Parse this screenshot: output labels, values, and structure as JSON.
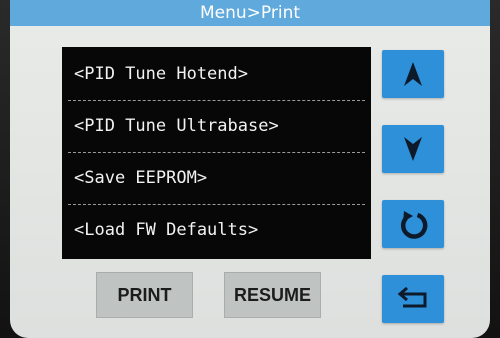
{
  "header": {
    "title": "Menu>Print"
  },
  "menu": {
    "items": [
      {
        "label": "<PID Tune Hotend>"
      },
      {
        "label": "<PID Tune Ultrabase>"
      },
      {
        "label": "<Save EEPROM>"
      },
      {
        "label": "<Load FW Defaults>"
      }
    ]
  },
  "side_buttons": [
    {
      "icon": "arrow-up-icon"
    },
    {
      "icon": "arrow-down-icon"
    },
    {
      "icon": "refresh-icon"
    },
    {
      "icon": "back-icon"
    }
  ],
  "bottom_buttons": {
    "print_label": "PRINT",
    "resume_label": "RESUME"
  },
  "colors": {
    "title_bar": "#5fa9dc",
    "side_button": "#2f90da",
    "menu_background": "#070707",
    "bottom_button": "#bfc3c2",
    "screen_background": "#e6e8e6"
  }
}
